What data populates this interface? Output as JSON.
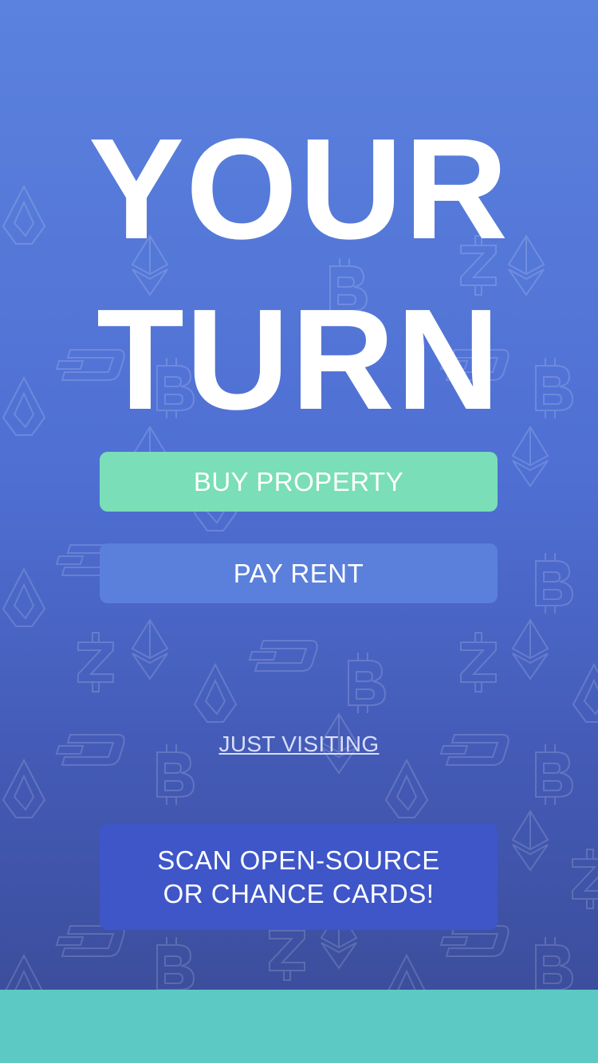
{
  "title": {
    "line1": "YOUR",
    "line2": "TURN"
  },
  "actions": {
    "buy_property": "BUY PROPERTY",
    "pay_rent": "PAY RENT",
    "just_visiting": "JUST VISITING",
    "scan_line1": "SCAN OPEN-SOURCE",
    "scan_line2": "OR CHANCE CARDS!"
  },
  "background_icons": [
    "bitcoin-icon",
    "ethereum-icon",
    "zcash-icon",
    "dash-icon",
    "lisk-icon"
  ],
  "colors": {
    "buy_button": "#7adeb8",
    "rent_button": "#5a80dc",
    "scan_button": "#3e56c8",
    "bottom_bar": "#5cc9c5"
  }
}
